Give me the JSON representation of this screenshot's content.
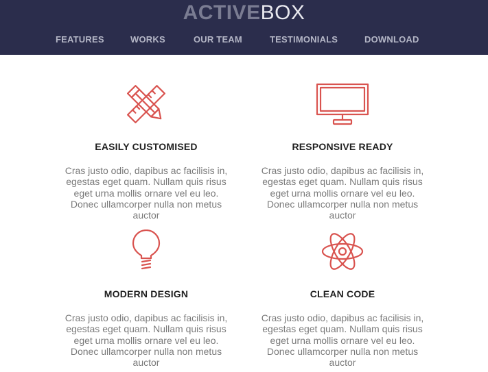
{
  "header": {
    "logo_bold": "ACTIVE",
    "logo_light": "BOX",
    "nav": [
      "FEATURES",
      "WORKS",
      "OUR TEAM",
      "TESTIMONIALS",
      "DOWNLOAD"
    ]
  },
  "features": [
    {
      "icon": "pencil-ruler-icon",
      "title": "EASILY CUSTOMISED",
      "desc": "Cras justo odio, dapibus ac facilisis in, egestas eget quam. Nullam quis risus eget urna mollis ornare vel eu leo. Donec ullamcorper nulla non metus auctor"
    },
    {
      "icon": "monitor-icon",
      "title": "RESPONSIVE READY",
      "desc": "Cras justo odio, dapibus ac facilisis in, egestas eget quam. Nullam quis risus eget urna mollis ornare vel eu leo. Donec ullamcorper nulla non metus auctor"
    },
    {
      "icon": "lightbulb-icon",
      "title": "MODERN DESIGN",
      "desc": "Cras justo odio, dapibus ac facilisis in, egestas eget quam. Nullam quis risus eget urna mollis ornare vel eu leo. Donec ullamcorper nulla non metus auctor"
    },
    {
      "icon": "atom-icon",
      "title": "CLEAN CODE",
      "desc": "Cras justo odio, dapibus ac facilisis in, egestas eget quam. Nullam quis risus eget urna mollis ornare vel eu leo. Donec ullamcorper nulla non metus auctor"
    }
  ],
  "colors": {
    "header_bg": "#2b2d4c",
    "accent": "#d9534f",
    "nav_text": "#b4b6c6",
    "body_text": "#7a7a7a"
  }
}
